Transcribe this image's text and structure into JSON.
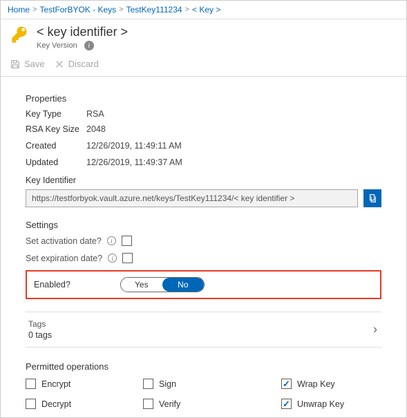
{
  "breadcrumb": {
    "items": [
      "Home",
      "TestForBYOK - Keys",
      "TestKey111234",
      "< Key >"
    ]
  },
  "header": {
    "title": "< key identifier >",
    "subtitle": "Key Version"
  },
  "toolbar": {
    "save": "Save",
    "discard": "Discard"
  },
  "properties": {
    "title": "Properties",
    "key_type_label": "Key Type",
    "key_type_value": "RSA",
    "key_size_label": "RSA Key Size",
    "key_size_value": "2048",
    "created_label": "Created",
    "created_value": "12/26/2019, 11:49:11 AM",
    "updated_label": "Updated",
    "updated_value": "12/26/2019, 11:49:37 AM",
    "key_identifier_label": "Key Identifier",
    "key_identifier_value": "https://testforbyok.vault.azure.net/keys/TestKey111234/< key identifier >"
  },
  "settings": {
    "title": "Settings",
    "activation_label": "Set activation date?",
    "expiration_label": "Set expiration date?",
    "enabled_label": "Enabled?",
    "toggle_yes": "Yes",
    "toggle_no": "No"
  },
  "tags": {
    "label": "Tags",
    "count": "0 tags"
  },
  "permitted": {
    "title": "Permitted operations",
    "ops": {
      "encrypt": "Encrypt",
      "sign": "Sign",
      "wrap": "Wrap Key",
      "decrypt": "Decrypt",
      "verify": "Verify",
      "unwrap": "Unwrap Key"
    }
  }
}
